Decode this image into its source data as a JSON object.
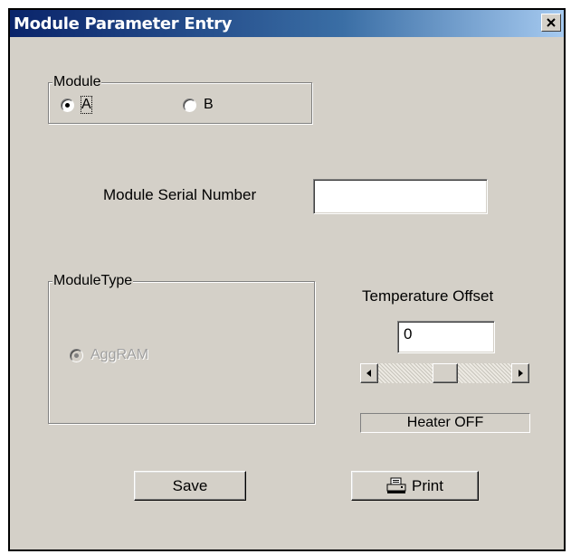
{
  "window": {
    "title": "Module Parameter Entry",
    "close_glyph": "X"
  },
  "module_group": {
    "legend": "Module",
    "options": [
      {
        "label": "A",
        "selected": true
      },
      {
        "label": "B",
        "selected": false
      }
    ]
  },
  "serial": {
    "label": "Module Serial Number",
    "value": ""
  },
  "module_type_group": {
    "legend": "ModuleType",
    "option": {
      "label": "AggRAM",
      "selected": true,
      "disabled": true
    }
  },
  "temperature": {
    "label": "Temperature Offset",
    "value": "0",
    "scroll_position": 0.5
  },
  "heater_status": {
    "text": "Heater OFF"
  },
  "buttons": {
    "save": "Save",
    "print": "Print"
  },
  "icons": {
    "close": "close-icon",
    "print": "printer-icon"
  },
  "colors": {
    "title_start": "#0a246a",
    "title_end": "#a6caf0",
    "face": "#d4d0c8"
  }
}
